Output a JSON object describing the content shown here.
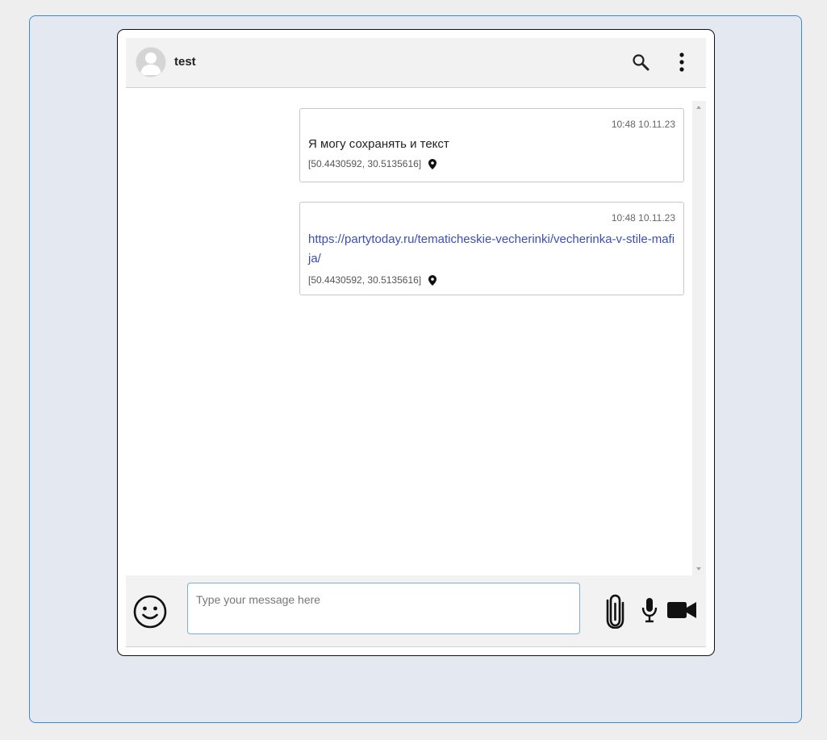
{
  "header": {
    "contact_name": "test"
  },
  "messages": [
    {
      "time": "10:48 10.11.23",
      "text": "Я могу сохранять и текст",
      "location": "[50.4430592, 30.5135616]"
    },
    {
      "time": "10:48 10.11.23",
      "link": "https://partytoday.ru/tematicheskie-vecherinki/vecherinka-v-stile-mafija/",
      "location": "[50.4430592, 30.5135616]"
    }
  ],
  "composer": {
    "value": "",
    "placeholder": "Type your message here"
  },
  "colors": {
    "panel_bg": "#e4e8f0",
    "panel_border": "#3b8ad9",
    "link": "#3a4fb8",
    "input_border": "#7aaee0"
  },
  "icons": {
    "avatar": "user-avatar-icon",
    "search": "search-icon",
    "menu": "more-vertical-icon",
    "location": "map-pin-icon",
    "emoji": "smiley-icon",
    "attach": "paperclip-icon",
    "mic": "microphone-icon",
    "video": "video-camera-icon"
  }
}
